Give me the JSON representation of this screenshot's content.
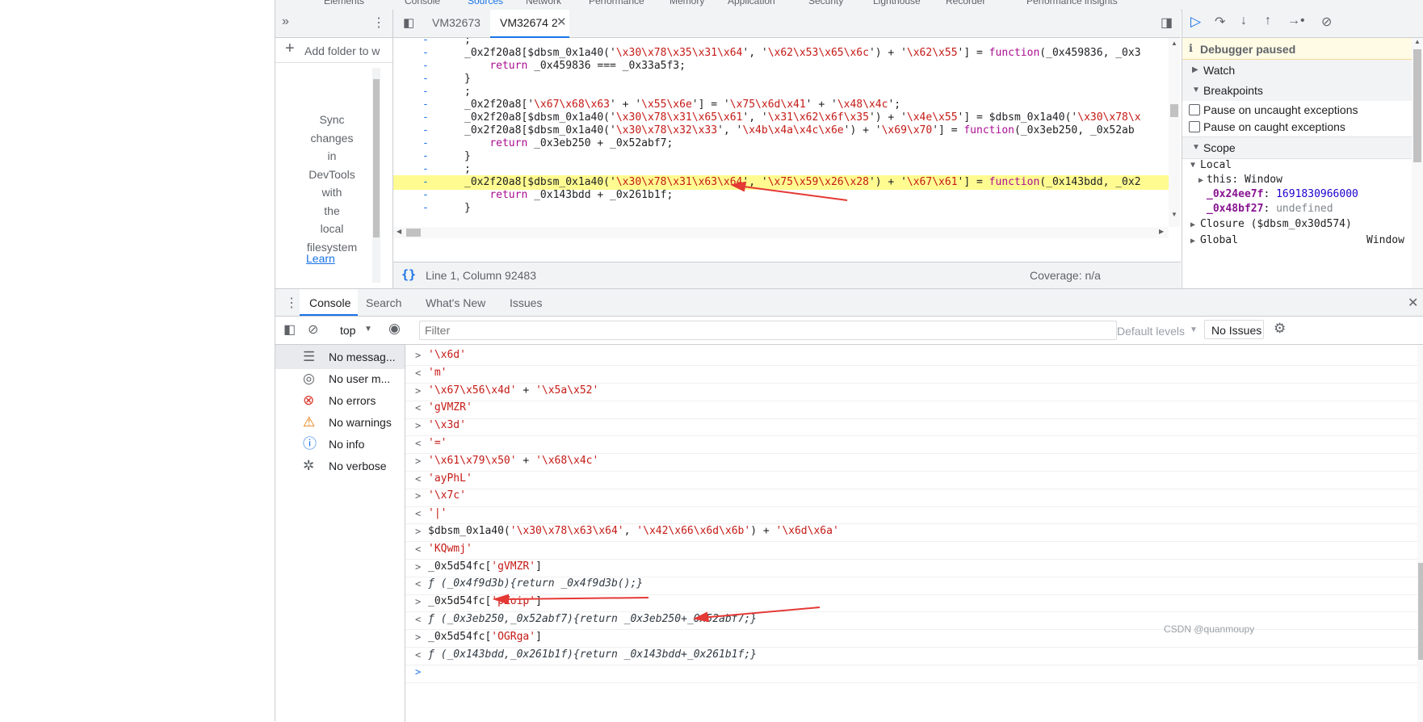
{
  "top_tabs": [
    "Elements",
    "Console",
    "Sources",
    "Network",
    "Performance",
    "Memory",
    "Application",
    "Security",
    "Lighthouse",
    "Recorder",
    "Performance insights"
  ],
  "navigator": {
    "add_folder": "Add folder to w",
    "sync_text": [
      "Sync",
      "changes",
      "in",
      "DevTools",
      "with",
      "the",
      "local",
      "filesystem"
    ],
    "learn": "Learn"
  },
  "editor": {
    "tabs": [
      {
        "label": "VM32673",
        "active": false
      },
      {
        "label": "VM32674 2",
        "active": true
      }
    ],
    "lines": [
      {
        "gutter": "-",
        "html": ";",
        "hl": false
      },
      {
        "gutter": "-",
        "html": "_0x2f20a8[$dbsm_0x1a40('<s>\\x30\\x78\\x35\\x31\\x64</s>', '<s>\\x62\\x53\\x65\\x6c</s>') + '<s>\\x62\\x55</s>'] = <k>function</k>(_0x459836, _0x3",
        "hl": false
      },
      {
        "gutter": "-",
        "html": "    <k>return</k> _0x459836 === _0x33a5f3;",
        "hl": false
      },
      {
        "gutter": "-",
        "html": "}",
        "hl": false
      },
      {
        "gutter": "-",
        "html": ";",
        "hl": false
      },
      {
        "gutter": "-",
        "html": "_0x2f20a8['<s>\\x67\\x68\\x63</s>' + '<s>\\x55\\x6e</s>'] = '<s>\\x75\\x6d\\x41</s>' + '<s>\\x48\\x4c</s>';",
        "hl": false
      },
      {
        "gutter": "-",
        "html": "_0x2f20a8[$dbsm_0x1a40('<s>\\x30\\x78\\x31\\x65\\x61</s>', '<s>\\x31\\x62\\x6f\\x35</s>') + '<s>\\x4e\\x55</s>'] = $dbsm_0x1a40('<s>\\x30\\x78\\x</s>",
        "hl": false
      },
      {
        "gutter": "-",
        "html": "_0x2f20a8[$dbsm_0x1a40('<s>\\x30\\x78\\x32\\x33</s>', '<s>\\x4b\\x4a\\x4c\\x6e</s>') + '<s>\\x69\\x70</s>'] = <k>function</k>(_0x3eb250, _0x52ab",
        "hl": false
      },
      {
        "gutter": "-",
        "html": "    <k>return</k> _0x3eb250 + _0x52abf7;",
        "hl": false
      },
      {
        "gutter": "-",
        "html": "}",
        "hl": false
      },
      {
        "gutter": "-",
        "html": ";",
        "hl": false
      },
      {
        "gutter": "-",
        "html": "_0x2f20a8[$dbsm_0x1a40('<s>\\x30\\x78\\x31\\x63\\x64</s>', '<s>\\x75\\x59\\x26\\x28</s>') + '<s>\\x67\\x61</s>'] = <k>function</k>(_0x143bdd, _0x2",
        "hl": true
      },
      {
        "gutter": "-",
        "html": "    <k>return</k> _0x143bdd + _0x261b1f;",
        "hl": false
      },
      {
        "gutter": "-",
        "html": "}",
        "hl": false
      }
    ],
    "status_position": "Line 1, Column 92483",
    "coverage": "Coverage: n/a"
  },
  "debugger": {
    "paused_label": "Debugger paused",
    "sections": {
      "watch": "Watch",
      "breakpoints": "Breakpoints",
      "scope": "Scope"
    },
    "uncaught": "Pause on uncaught exceptions",
    "caught": "Pause on caught exceptions",
    "scope": {
      "local": "Local",
      "this_key": "this",
      "this_val": "Window",
      "var1_key": "_0x24ee7f",
      "var1_val": "1691830966000",
      "var2_key": "_0x48bf27",
      "var2_val": "undefined",
      "closure": "Closure ($dbsm_0x30d574)",
      "global": "Global",
      "global_val": "Window"
    }
  },
  "drawer": {
    "tabs": [
      "Console",
      "Search",
      "What's New",
      "Issues"
    ],
    "context": "top",
    "filter_placeholder": "Filter",
    "levels": "Default levels",
    "issues": "No Issues"
  },
  "sidebar": [
    {
      "label": "No messag...",
      "icon": "list-icon",
      "color": "#5f6368"
    },
    {
      "label": "No user m...",
      "icon": "user-icon",
      "color": "#5f6368"
    },
    {
      "label": "No errors",
      "icon": "error-icon",
      "color": "#d93025"
    },
    {
      "label": "No warnings",
      "icon": "warning-icon",
      "color": "#e37400"
    },
    {
      "label": "No info",
      "icon": "info-icon",
      "color": "#1a73e8"
    },
    {
      "label": "No verbose",
      "icon": "bug-icon",
      "color": "#5f6368"
    }
  ],
  "console_lines": [
    {
      "prompt": ">",
      "kind": "in",
      "html": "<s>'\\x6d'</s>"
    },
    {
      "prompt": "<",
      "kind": "out",
      "html": "<s>'m'</s>"
    },
    {
      "prompt": ">",
      "kind": "in",
      "html": "<s>'\\x67\\x56\\x4d'</s> + <s>'\\x5a\\x52'</s>"
    },
    {
      "prompt": "<",
      "kind": "out",
      "html": "<s>'gVMZR'</s>"
    },
    {
      "prompt": ">",
      "kind": "in",
      "html": "<s>'\\x3d'</s>"
    },
    {
      "prompt": "<",
      "kind": "out",
      "html": "<s>'='</s>"
    },
    {
      "prompt": ">",
      "kind": "in",
      "html": "<s>'\\x61\\x79\\x50'</s> + <s>'\\x68\\x4c'</s>"
    },
    {
      "prompt": "<",
      "kind": "out",
      "html": "<s>'ayPhL'</s>"
    },
    {
      "prompt": ">",
      "kind": "in",
      "html": "<s>'\\x7c'</s>"
    },
    {
      "prompt": "<",
      "kind": "out",
      "html": "<s>'|'</s>"
    },
    {
      "prompt": ">",
      "kind": "in",
      "html": "$dbsm_0x1a40(<s>'\\x30\\x78\\x63\\x64'</s>, <s>'\\x42\\x66\\x6d\\x6b'</s>) + <s>'\\x6d\\x6a'</s>"
    },
    {
      "prompt": "<",
      "kind": "out",
      "html": "<s>'KQwmj'</s>"
    },
    {
      "prompt": ">",
      "kind": "in",
      "html": "_0x5d54fc[<s>'gVMZR'</s>]"
    },
    {
      "prompt": "<",
      "kind": "fn",
      "html": "<i>ƒ (_0x4f9d3b){return _0x4f9d3b();}</i>"
    },
    {
      "prompt": ">",
      "kind": "in",
      "html": "_0x5d54fc[<s>'pZoip'</s>]"
    },
    {
      "prompt": "<",
      "kind": "fn",
      "html": "<i>ƒ (_0x3eb250,_0x52abf7){return _0x3eb250+_0x52abf7;}</i>"
    },
    {
      "prompt": ">",
      "kind": "in",
      "html": "_0x5d54fc[<s>'OGRga'</s>]"
    },
    {
      "prompt": "<",
      "kind": "fn",
      "html": "<i>ƒ (_0x143bdd,_0x261b1f){return _0x143bdd+_0x261b1f;}</i>"
    },
    {
      "prompt": ">",
      "kind": "input",
      "html": ""
    }
  ],
  "watermark": "CSDN @quanmoupy",
  "colors": {
    "string": "#c41a16",
    "keyword": "#aa0d91",
    "accent": "#1a73e8",
    "highlight": "#fffb91",
    "arrow": "#e53935"
  }
}
